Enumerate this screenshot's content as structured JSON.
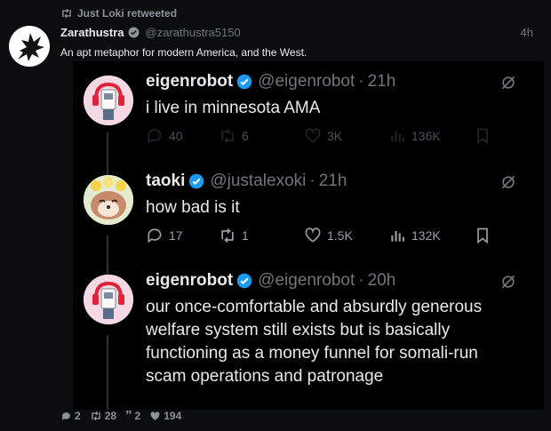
{
  "retweet": {
    "label": "Just Loki retweeted"
  },
  "outer": {
    "name": "Zarathustra",
    "handle": "@zarathustra5150",
    "time": "4h",
    "text": "An apt metaphor for modern America, and the West.",
    "stats": {
      "replies": "2",
      "retweets": "28",
      "quotes": "2",
      "likes": "194"
    }
  },
  "thread": [
    {
      "name": "eigenrobot",
      "handle": "@eigenrobot",
      "time": "21h",
      "text": "i live in minnesota AMA",
      "stats": {
        "replies": "40",
        "retweets": "6",
        "likes": "3K",
        "views": "136K"
      }
    },
    {
      "name": "taoki",
      "handle": "@justalexoki",
      "time": "21h",
      "text": "how bad is it",
      "stats": {
        "replies": "17",
        "retweets": "1",
        "likes": "1.5K",
        "views": "132K"
      }
    },
    {
      "name": "eigenrobot",
      "handle": "@eigenrobot",
      "time": "20h",
      "text": "our once-comfortable and absurdly generous welfare system still exists but is basically functioning as a money funnel for somali-run scam operations and patronage"
    }
  ],
  "colors": {
    "verified": "#1d9bf0",
    "background": "#000000",
    "muted": "#71767b"
  }
}
